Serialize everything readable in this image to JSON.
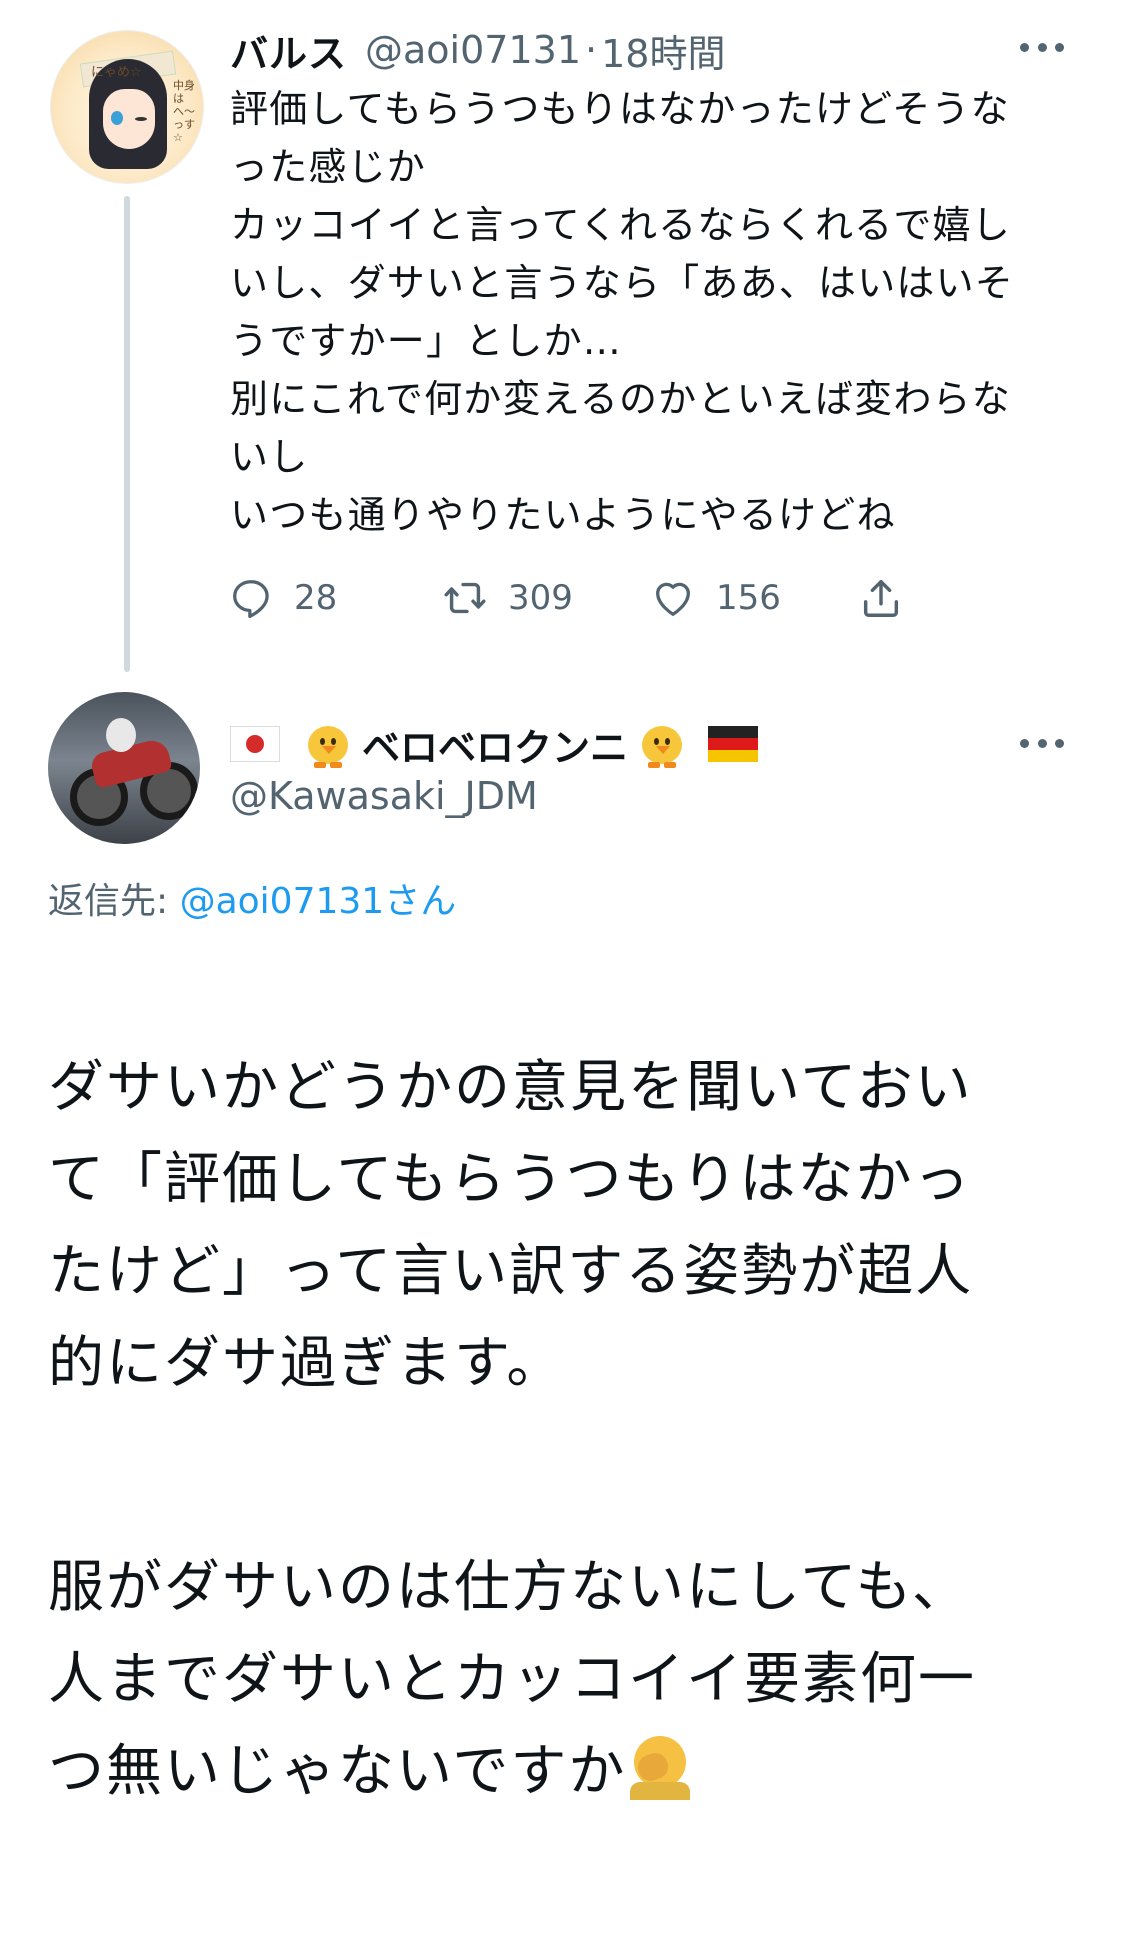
{
  "tweet1": {
    "display_name": "バルス",
    "handle": "@aoi07131",
    "separator": "·",
    "time": "18時間",
    "avatar": {
      "badge_text": "にゃめ☆",
      "side_text": "中身は\nへ〜っす☆"
    },
    "text": "評価してもらうつもりはなかったけどそうな\nった感じか\nカッコイイと言ってくれるならくれるで嬉し\nいし、ダサいと言うなら「ああ、はいはいそ\nうですかー」としか…\n別にこれで何か変えるのかといえば変わらな\nいし\nいつも通りやりたいようにやるけどね",
    "replies": "28",
    "retweets": "309",
    "likes": "156"
  },
  "tweet2": {
    "display_name": "ベロベロクンニ",
    "handle": "@Kawasaki_JDM",
    "reply_prefix": "返信先: ",
    "reply_to": "@aoi07131さん",
    "paragraph1": "ダサいかどうかの意見を聞いておい\nて「評価してもらうつもりはなかっ\nたけど」って言い訳する姿勢が超人\n的にダサ過ぎます。",
    "paragraph2": "服がダサいのは仕方ないにしても、\n人までダサいとカッコイイ要素何一\nつ無いじゃないですか"
  },
  "icons": [
    "more-icon",
    "reply-icon",
    "retweet-icon",
    "like-icon",
    "share-icon",
    "flag-japan",
    "baby-chick",
    "flag-germany",
    "facepalm-emoji"
  ],
  "colors": {
    "text": "#0f1419",
    "secondary": "#536471",
    "link": "#1d9bf0",
    "thread_line": "#cfd9de"
  }
}
